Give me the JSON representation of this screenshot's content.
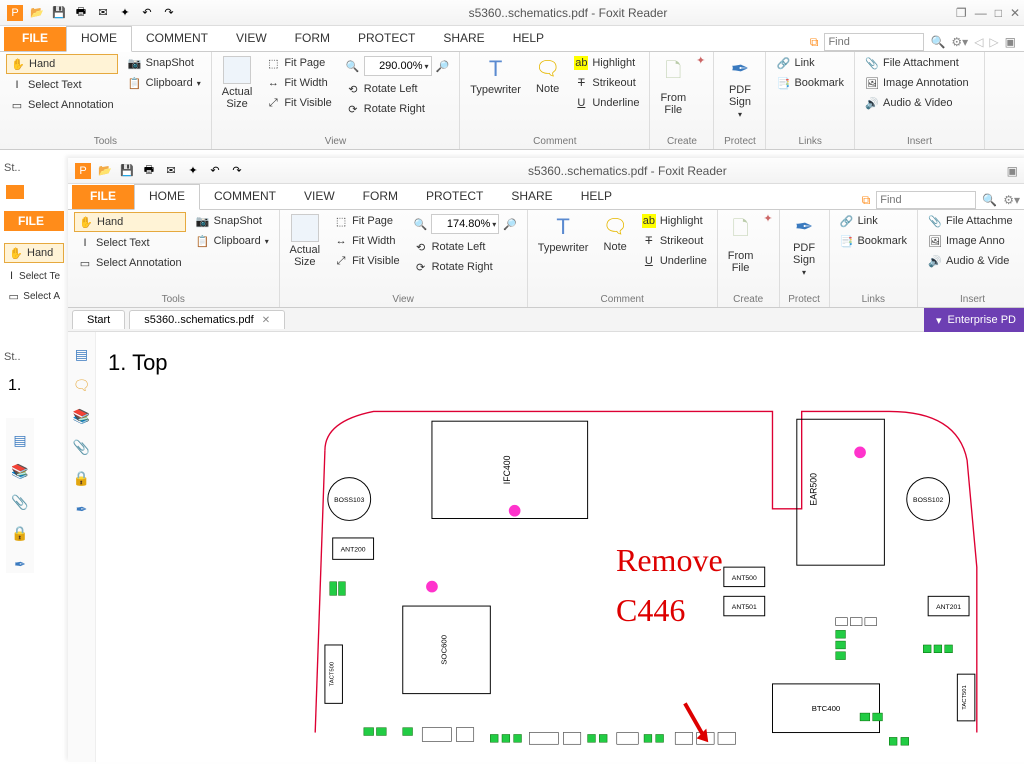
{
  "app": {
    "title": "s5360..schematics.pdf - Foxit Reader",
    "title2": "s5360..schematics.pdf - Foxit Reader"
  },
  "menu": {
    "file": "FILE",
    "home": "HOME",
    "comment": "COMMENT",
    "view": "VIEW",
    "form": "FORM",
    "protect": "PROTECT",
    "share": "SHARE",
    "help": "HELP"
  },
  "find": {
    "placeholder": "Find"
  },
  "tools": {
    "hand": "Hand",
    "selectText": "Select Text",
    "selectAnn": "Select Annotation",
    "snapshot": "SnapShot",
    "clipboard": "Clipboard",
    "label": "Tools"
  },
  "view": {
    "actual": "Actual\nSize",
    "fitPage": "Fit Page",
    "fitWidth": "Fit Width",
    "fitVisible": "Fit Visible",
    "rotateLeft": "Rotate Left",
    "rotateRight": "Rotate Right",
    "zoom1": "290.00%",
    "zoom2": "174.80%",
    "label": "View"
  },
  "comment": {
    "typewriter": "Typewriter",
    "note": "Note",
    "highlight": "Highlight",
    "strikeout": "Strikeout",
    "underline": "Underline",
    "label": "Comment"
  },
  "create": {
    "fromFile": "From\nFile",
    "label": "Create"
  },
  "protect": {
    "pdfsign": "PDF\nSign",
    "label": "Protect"
  },
  "links": {
    "link": "Link",
    "bookmark": "Bookmark",
    "label": "Links"
  },
  "insert": {
    "fileAtt": "File Attachment",
    "imgAnn": "Image Annotation",
    "audioVideo": "Audio & Video",
    "label": "Insert"
  },
  "tabs": {
    "start": "Start",
    "doc": "s5360..schematics.pdf"
  },
  "enterprise": "Enterprise PD",
  "page": {
    "section": "1.  Top",
    "section1": "1."
  },
  "schem": {
    "boss1": "BOSS103",
    "boss2": "BOSS102",
    "ifc": "IFC400",
    "ear": "EAR500",
    "ant200": "ANT200",
    "ant500": "ANT500",
    "ant501": "ANT501",
    "ant201": "ANT201",
    "soc": "SOC600",
    "tact500": "TACT500",
    "tact501": "TACT501",
    "btc": "BTC400",
    "remove": "Remove",
    "c446": "C446"
  }
}
